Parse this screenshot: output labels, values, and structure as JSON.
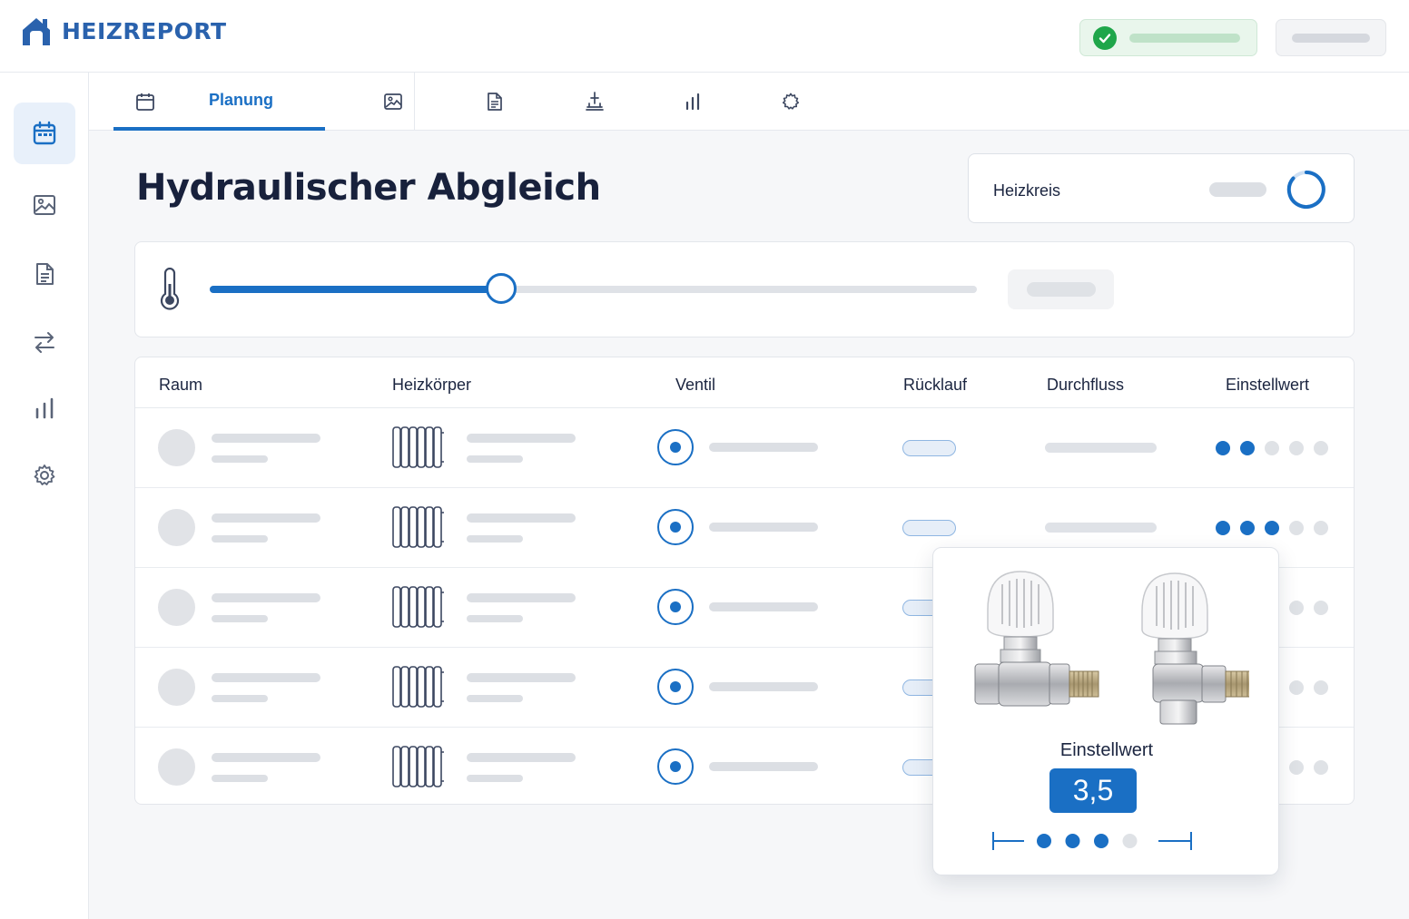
{
  "app": {
    "name": "HEIZREPORT",
    "colors": {
      "brand": "#2a62ad",
      "accent": "#1a6fc4",
      "success": "#1fa64a"
    }
  },
  "header": {
    "status_icon": "check-circle-icon"
  },
  "sidebar": {
    "items": [
      {
        "icon": "calendar-icon",
        "active": true
      },
      {
        "icon": "image-icon",
        "active": false
      },
      {
        "icon": "document-icon",
        "active": false
      },
      {
        "icon": "transfer-arrows-icon",
        "active": false
      },
      {
        "icon": "bar-chart-icon",
        "active": false
      },
      {
        "icon": "gear-icon",
        "active": false
      }
    ]
  },
  "tabs": [
    {
      "label": "Planung",
      "icon": "calendar-icon",
      "active": true
    },
    {
      "label": "",
      "icon": "image-icon"
    },
    {
      "label": "",
      "icon": "document-icon"
    },
    {
      "label": "",
      "icon": "network-icon"
    },
    {
      "label": "",
      "icon": "bar-chart-icon"
    },
    {
      "label": "",
      "icon": "gear-icon"
    }
  ],
  "page": {
    "title": "Hydraulischer Abgleich"
  },
  "heizkreis": {
    "label": "Heizkreis",
    "icon": "loading-ring-icon"
  },
  "temperature_slider": {
    "icon": "thermometer-icon",
    "level_fraction": 0.38
  },
  "table": {
    "columns": [
      "Raum",
      "Heizkörper",
      "Ventil",
      "Rücklauf",
      "Durchfluss",
      "Einstellwert"
    ],
    "rows": [
      {
        "flow_fraction": 0.43,
        "setting_dots": 2
      },
      {
        "flow_fraction": 0.55,
        "setting_dots": 3
      },
      {
        "flow_fraction": 0.4,
        "setting_dots": 2
      },
      {
        "flow_fraction": 0.4,
        "setting_dots": 2
      },
      {
        "flow_fraction": 0.4,
        "setting_dots": 2
      }
    ],
    "dots_total": 5
  },
  "popover": {
    "label": "Einstellwert",
    "value": "3,5",
    "scale_dots_on": 3,
    "scale_dots_total": 4
  }
}
